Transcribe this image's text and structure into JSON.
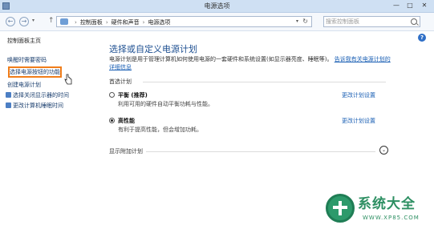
{
  "window": {
    "title": "电源选项"
  },
  "address": {
    "crumbs": [
      "控制面板",
      "硬件和声音",
      "电源选项"
    ],
    "search_placeholder": "搜索控制面板"
  },
  "sidebar": {
    "items": [
      {
        "label": "控制面板主页"
      },
      {
        "label": "唤醒时需要密码"
      },
      {
        "label": "选择电源按钮的功能"
      },
      {
        "label": "创建电源计划"
      },
      {
        "label": "选择关闭显示器的时间"
      },
      {
        "label": "更改计算机睡眠时间"
      }
    ]
  },
  "main": {
    "title": "选择或自定义电源计划",
    "description": "电源计划是用于管理计算机如何使用电源的一套硬件和系统设置(如显示器亮度、睡眠等)。",
    "description_link": "告诉我有关电源计划的详细信息",
    "section_label": "首选计划",
    "plans": [
      {
        "name": "平衡 (推荐)",
        "desc": "利用可用的硬件自动平衡功耗与性能。",
        "link": "更改计划设置",
        "selected": false
      },
      {
        "name": "高性能",
        "desc": "有利于提高性能，但会增加功耗。",
        "link": "更改计划设置",
        "selected": true
      }
    ],
    "more_plans_label": "显示附加计划"
  },
  "watermark": {
    "brand": "系统大全",
    "url": "WWW.XP85.COM"
  }
}
